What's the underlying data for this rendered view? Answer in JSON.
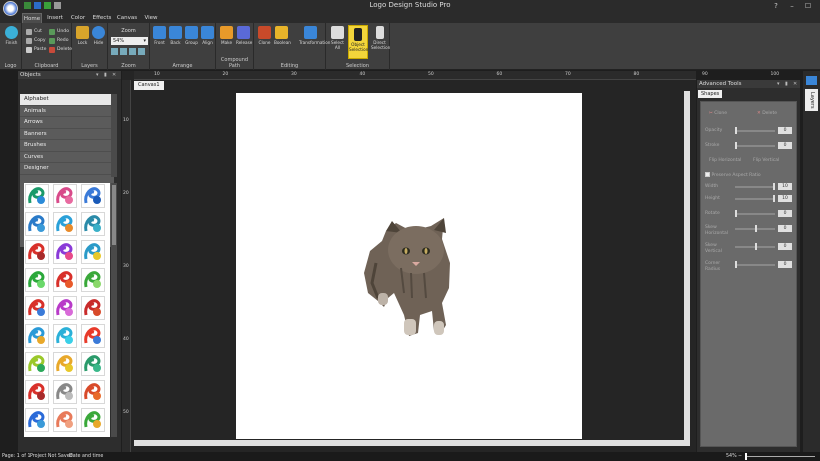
{
  "window": {
    "title": "Logo Design Studio Pro",
    "controls": [
      "?",
      "–",
      "☐",
      "✕"
    ]
  },
  "menu": {
    "tabs": [
      "Home",
      "Insert",
      "Color",
      "Effects",
      "Canvas",
      "View"
    ],
    "active": "Home"
  },
  "ribbon": {
    "finish": {
      "label": "Finish"
    },
    "clipboard": {
      "cut": "Cut",
      "copy": "Copy",
      "paste": "Paste",
      "undo": "Undo",
      "redo": "Redo",
      "delete": "Delete",
      "group_label": "Clipboard"
    },
    "logo_group_label": "Logo",
    "layers": {
      "lock": "Lock",
      "hide": "Hide",
      "group_label": "Layers"
    },
    "zoom": {
      "title": "Zoom",
      "value": "54%",
      "group_label": "Zoom"
    },
    "arrange": {
      "front": "Front",
      "back": "Back",
      "group": "Group",
      "align": "Align",
      "group_label": "Arrange"
    },
    "compound": {
      "make": "Make",
      "release": "Release",
      "group_label": "Compound Path"
    },
    "editing": {
      "clone": "Clone",
      "boolean": "Boolean",
      "transformation": "Transformation",
      "group_label": "Editing"
    },
    "selection": {
      "select_all": "Select All",
      "object_selection": "Object Selection",
      "direct_selection": "Direct Selection",
      "group_label": "Selection"
    }
  },
  "objects_panel": {
    "title": "Objects",
    "categories": [
      "Alphabet",
      "Animals",
      "Arrows",
      "Banners",
      "Brushes",
      "Curves",
      "Designer"
    ],
    "selected": "Alphabet"
  },
  "canvas": {
    "tab": "Canvas1",
    "ruler_h": [
      "10",
      "20",
      "30",
      "40",
      "50",
      "60",
      "70",
      "80",
      "90",
      "100"
    ],
    "ruler_v": [
      "10",
      "20",
      "30",
      "40",
      "50"
    ],
    "artwork": "tabby-cat-image"
  },
  "advanced_tools": {
    "title": "Advanced Tools",
    "tab": "Shapes",
    "clone": "Clone",
    "delete": "Delete",
    "opacity": {
      "label": "Opacity",
      "value": "0"
    },
    "stroke": {
      "label": "Stroke",
      "value": "0"
    },
    "flip_h": "Flip Horizontal",
    "flip_v": "Flip Vertical",
    "preserve": "Preserve Aspect Ratio",
    "width": {
      "label": "Width",
      "value": "10"
    },
    "height": {
      "label": "Height",
      "value": "10"
    },
    "rotate": {
      "label": "Rotate",
      "value": "0"
    },
    "skew_h": {
      "label": "Skew Horizontal",
      "value": "0"
    },
    "skew_v": {
      "label": "Skew Vertical",
      "value": "0"
    },
    "corner": {
      "label": "Corner Radius",
      "value": "0"
    }
  },
  "layers_tab": "Layers",
  "status": {
    "page": "Page: 1 of 1",
    "saved": "Project Not Saved",
    "datetime": "Date and time",
    "zoom": "54%"
  }
}
